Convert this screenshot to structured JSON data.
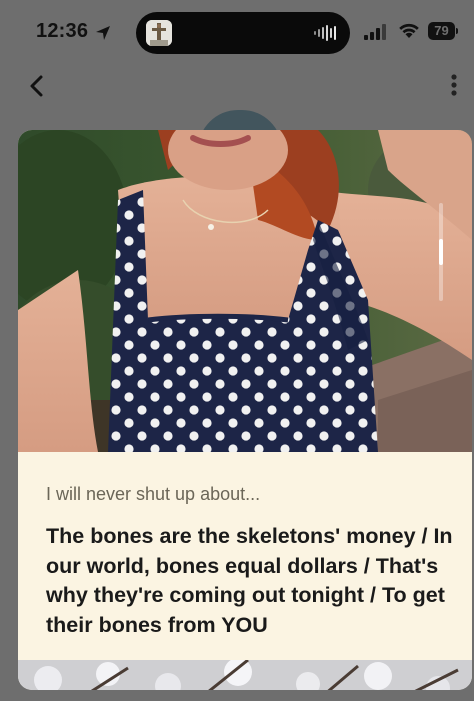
{
  "status_bar": {
    "time": "12:36",
    "battery": "79",
    "icons": [
      "location-arrow-icon",
      "audio-wave-icon",
      "cellular-signal-icon",
      "wifi-icon",
      "battery-icon"
    ]
  },
  "nav": {
    "back_icon": "chevron-left-icon",
    "more_icon": "vertical-ellipsis-icon"
  },
  "prompt": {
    "label": "I will never shut up about...",
    "answer": "The bones are the skeletons' money / In our world, bones equal dollars / That's why they're coming out tonight / To get their bones from YOU"
  },
  "colors": {
    "background": "#6e6e6e",
    "card": "#fbf4e2",
    "text_primary": "#1a1a1a",
    "text_secondary": "#6b6658"
  }
}
